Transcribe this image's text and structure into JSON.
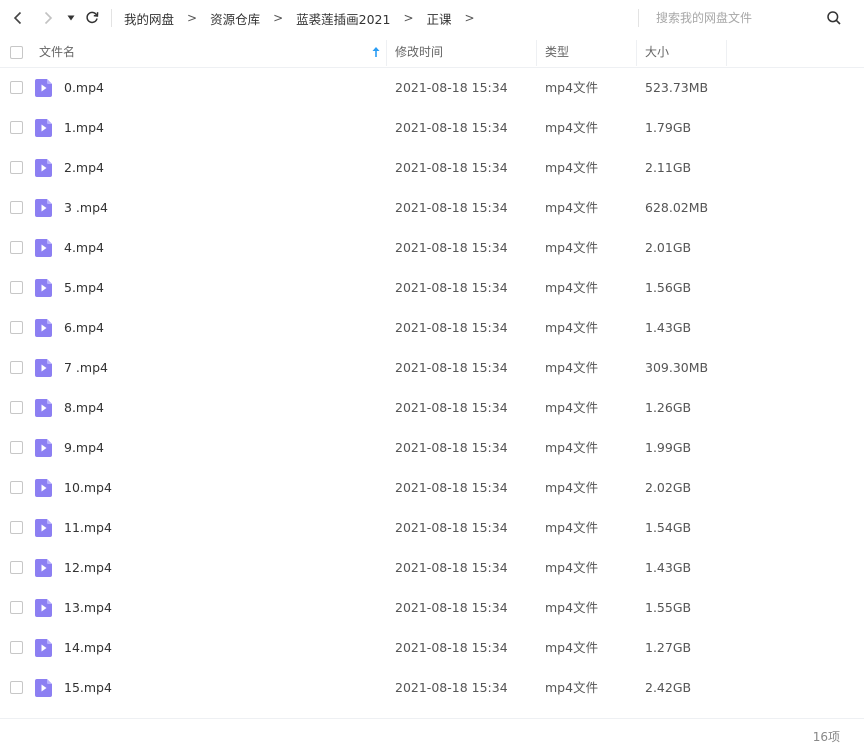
{
  "toolbar": {
    "breadcrumb": [
      "我的网盘",
      "资源仓库",
      "蓝裘莲插画2021",
      "正课"
    ],
    "breadcrumb_separator": ">",
    "search_placeholder": "搜索我的网盘文件"
  },
  "columns": {
    "name": "文件名",
    "modified": "修改时间",
    "type": "类型",
    "size": "大小"
  },
  "files": [
    {
      "name": "0.mp4",
      "modified": "2021-08-18 15:34",
      "type": "mp4文件",
      "size": "523.73MB"
    },
    {
      "name": "1.mp4",
      "modified": "2021-08-18 15:34",
      "type": "mp4文件",
      "size": "1.79GB"
    },
    {
      "name": "2.mp4",
      "modified": "2021-08-18 15:34",
      "type": "mp4文件",
      "size": "2.11GB"
    },
    {
      "name": "3 .mp4",
      "modified": "2021-08-18 15:34",
      "type": "mp4文件",
      "size": "628.02MB"
    },
    {
      "name": "4.mp4",
      "modified": "2021-08-18 15:34",
      "type": "mp4文件",
      "size": "2.01GB"
    },
    {
      "name": "5.mp4",
      "modified": "2021-08-18 15:34",
      "type": "mp4文件",
      "size": "1.56GB"
    },
    {
      "name": "6.mp4",
      "modified": "2021-08-18 15:34",
      "type": "mp4文件",
      "size": "1.43GB"
    },
    {
      "name": "7 .mp4",
      "modified": "2021-08-18 15:34",
      "type": "mp4文件",
      "size": "309.30MB"
    },
    {
      "name": "8.mp4",
      "modified": "2021-08-18 15:34",
      "type": "mp4文件",
      "size": "1.26GB"
    },
    {
      "name": "9.mp4",
      "modified": "2021-08-18 15:34",
      "type": "mp4文件",
      "size": "1.99GB"
    },
    {
      "name": "10.mp4",
      "modified": "2021-08-18 15:34",
      "type": "mp4文件",
      "size": "2.02GB"
    },
    {
      "name": "11.mp4",
      "modified": "2021-08-18 15:34",
      "type": "mp4文件",
      "size": "1.54GB"
    },
    {
      "name": "12.mp4",
      "modified": "2021-08-18 15:34",
      "type": "mp4文件",
      "size": "1.43GB"
    },
    {
      "name": "13.mp4",
      "modified": "2021-08-18 15:34",
      "type": "mp4文件",
      "size": "1.55GB"
    },
    {
      "name": "14.mp4",
      "modified": "2021-08-18 15:34",
      "type": "mp4文件",
      "size": "1.27GB"
    },
    {
      "name": "15.mp4",
      "modified": "2021-08-18 15:34",
      "type": "mp4文件",
      "size": "2.42GB"
    }
  ],
  "footer": {
    "item_count": "16项"
  },
  "icons": {
    "back": "chevron-left-icon",
    "forward": "chevron-right-icon",
    "history": "caret-down-icon",
    "refresh": "refresh-icon",
    "search": "search-icon",
    "sort": "sort-ascending-icon",
    "file": "video-file-icon"
  },
  "colors": {
    "file_icon": "#8c7ff2",
    "file_icon_fold": "#b8b0ff",
    "sort_arrow": "#2a9df4",
    "divider": "#eef0f3"
  }
}
